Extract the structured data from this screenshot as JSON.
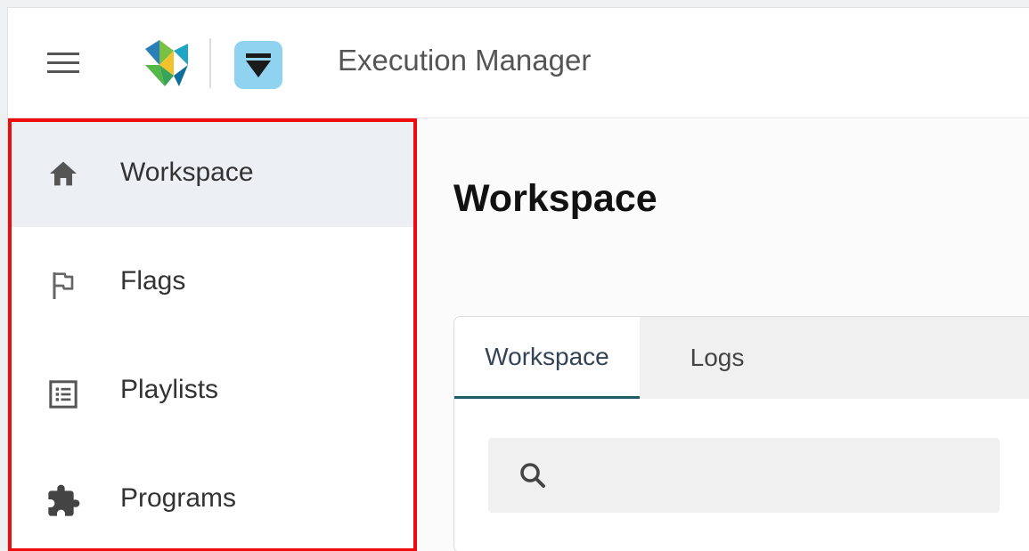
{
  "header": {
    "app_title": "Execution Manager",
    "menu_icon": "hamburger-icon",
    "logo_icon": "hexagon-logo-icon",
    "app_icon": "funnel-app-icon"
  },
  "sidebar": {
    "items": [
      {
        "label": "Workspace",
        "icon": "home-icon",
        "active": true
      },
      {
        "label": "Flags",
        "icon": "flag-icon",
        "active": false
      },
      {
        "label": "Playlists",
        "icon": "list-icon",
        "active": false
      },
      {
        "label": "Programs",
        "icon": "puzzle-icon",
        "active": false
      }
    ]
  },
  "main": {
    "page_title": "Workspace",
    "tabs": [
      {
        "label": "Workspace",
        "active": true
      },
      {
        "label": "Logs",
        "active": false
      }
    ],
    "search": {
      "value": "",
      "placeholder": "",
      "icon": "search-icon"
    }
  },
  "colors": {
    "highlight": "#ee0d0d",
    "active_nav_bg": "#ecf0f4",
    "active_tab_underline": "#1f5b69"
  }
}
